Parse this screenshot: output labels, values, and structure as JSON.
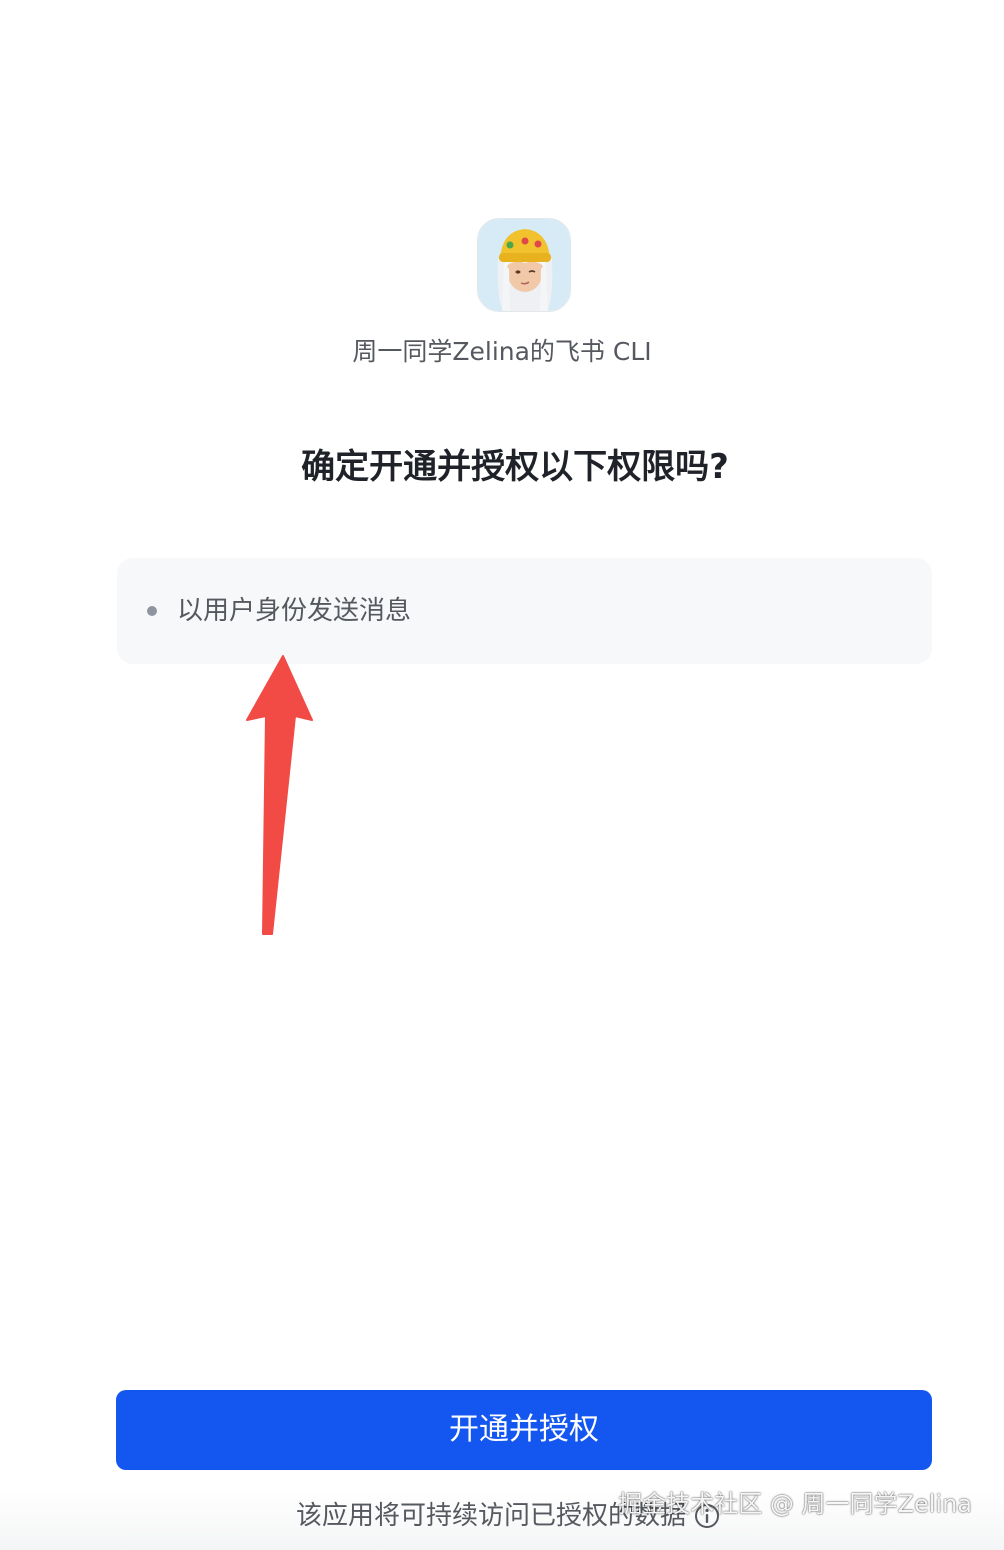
{
  "app": {
    "name": "周一同学Zelina的飞书 CLI",
    "logo_icon": "avatar-girl-yellow-beanie"
  },
  "dialog": {
    "title": "确定开通并授权以下权限吗?"
  },
  "permissions": {
    "items": [
      {
        "label": "以用户身份发送消息"
      }
    ]
  },
  "actions": {
    "authorize_label": "开通并授权"
  },
  "footer": {
    "note": "该应用将可持续访问已授权的数据",
    "info_icon": "info-circle-icon"
  },
  "watermark": {
    "text": "掘金技术社区 @ 周一同学Zelina"
  },
  "colors": {
    "primary": "#1456f0",
    "annotation_arrow": "#f24a45",
    "title_text": "#1f2329",
    "secondary_text": "#55595f",
    "permission_box_bg": "#f7f8fa"
  }
}
